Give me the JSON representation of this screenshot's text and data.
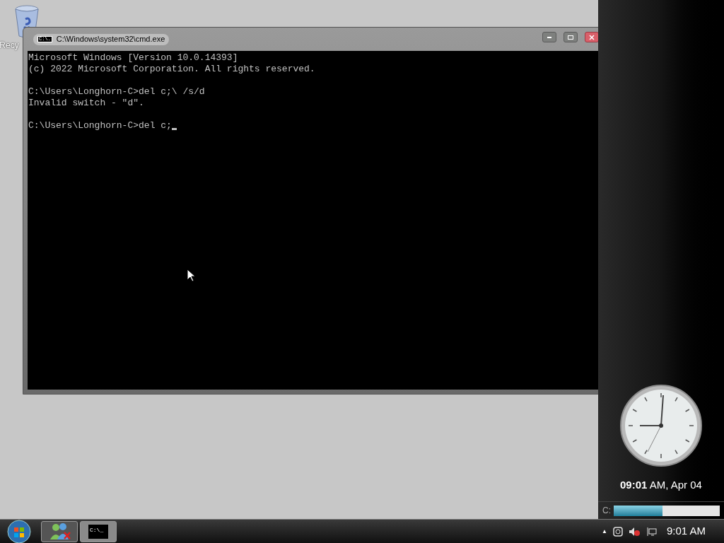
{
  "desktop": {
    "icons": [
      {
        "label": "Recy"
      }
    ]
  },
  "window": {
    "title": "C:\\Windows\\system32\\cmd.exe",
    "icon_text": "C:\\.",
    "blocks": [
      {
        "lines": [
          "Microsoft Windows [Version 10.0.14393]",
          "(c) 2022 Microsoft Corporation. All rights reserved."
        ]
      },
      {
        "lines": [
          "C:\\Users\\Longhorn-C>del c;\\ /s/d",
          "Invalid switch - \"d\"."
        ]
      },
      {
        "lines": [
          "C:\\Users\\Longhorn-C>del c;"
        ]
      }
    ]
  },
  "sidebar": {
    "clock": {
      "time": "09:01",
      "rest": " AM, Apr 04"
    },
    "drive": {
      "label": "C:",
      "level": 0.46
    }
  },
  "taskbar": {
    "buttons": [
      {
        "kind": "messenger",
        "selected": false
      },
      {
        "kind": "console",
        "text": "C:\\_",
        "selected": true
      }
    ],
    "tray": {
      "arrow": "▲",
      "time": "9:01 AM"
    }
  }
}
